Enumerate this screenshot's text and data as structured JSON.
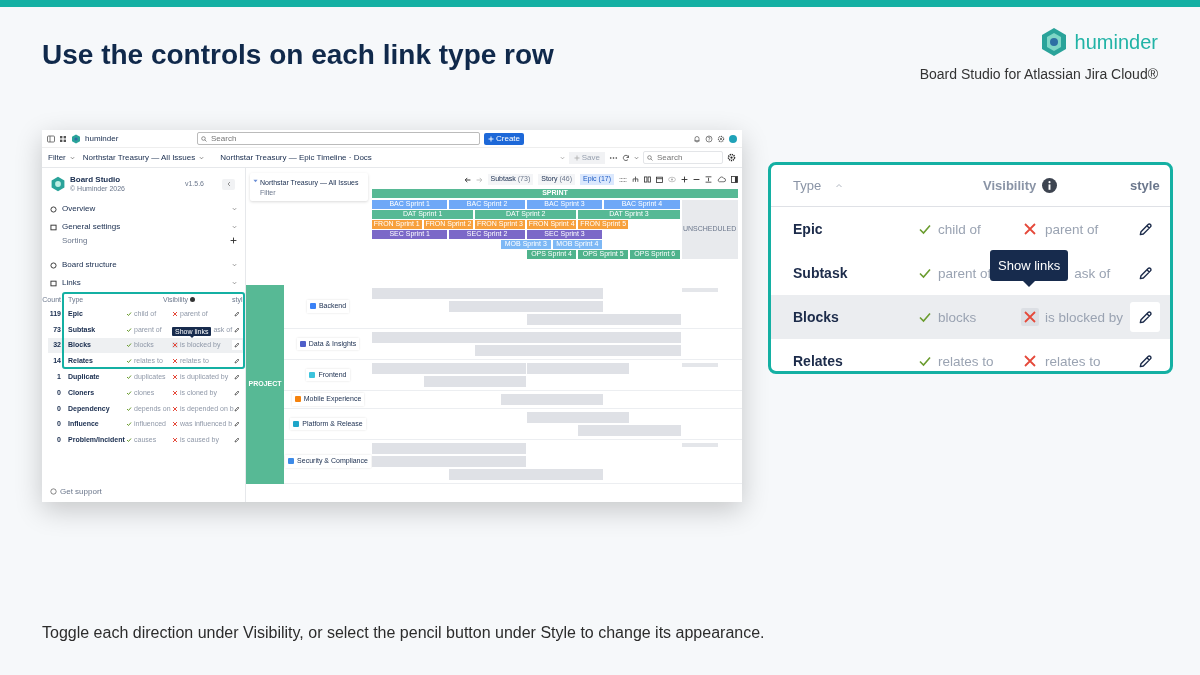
{
  "slide": {
    "title": "Use the controls on each link type row",
    "brand": "huminder",
    "product": "Board Studio for Atlassian Jira Cloud®",
    "caption": "Toggle each direction under Visibility, or select the pencil button under Style to change its appearance."
  },
  "app": {
    "topbar": {
      "brand": "huminder",
      "search_placeholder": "Search",
      "create": "Create"
    },
    "filterbar": {
      "filter": "Filter",
      "board": "Northstar Treasury — All Issues",
      "view": "Northstar Treasury — Epic Timeline · Docs",
      "save": "Save",
      "search_placeholder": "Search"
    },
    "sidebar": {
      "app_name": "Board Studio",
      "copyright": "© Huminder 2026",
      "version": "v1.5.6",
      "sections": [
        {
          "label": "Overview"
        },
        {
          "label": "General settings",
          "children": [
            {
              "label": "Sorting"
            }
          ]
        },
        {
          "label": "Board structure"
        },
        {
          "label": "Links"
        }
      ],
      "links_table": {
        "columns": [
          "Count",
          "Type",
          "Visibility",
          "styl"
        ],
        "rows": [
          {
            "count": "119",
            "type": "Epic",
            "forward": "child of",
            "reverse": "parent of",
            "forward_on": true,
            "reverse_on": false,
            "selected": false
          },
          {
            "count": "73",
            "type": "Subtask",
            "forward": "parent of",
            "reverse": "ask of",
            "forward_on": true,
            "selected": false,
            "tooltip": "Show links"
          },
          {
            "count": "32",
            "type": "Blocks",
            "forward": "blocks",
            "reverse": "is blocked by",
            "forward_on": true,
            "reverse_on": false,
            "selected": true
          },
          {
            "count": "14",
            "type": "Relates",
            "forward": "relates to",
            "reverse": "relates to",
            "forward_on": true,
            "reverse_on": false,
            "selected": false
          },
          {
            "count": "1",
            "type": "Duplicate",
            "forward": "duplicates",
            "reverse": "is duplicated by",
            "forward_on": true,
            "reverse_on": false,
            "selected": false
          },
          {
            "count": "0",
            "type": "Cloners",
            "forward": "clones",
            "reverse": "is cloned by",
            "forward_on": true,
            "reverse_on": false,
            "selected": false
          },
          {
            "count": "0",
            "type": "Dependency",
            "forward": "depends on",
            "reverse": "is depended on b",
            "forward_on": true,
            "reverse_on": false,
            "selected": false
          },
          {
            "count": "0",
            "type": "Influence",
            "forward": "influenced",
            "reverse": "was influenced b",
            "forward_on": true,
            "reverse_on": false,
            "selected": false
          },
          {
            "count": "0",
            "type": "Problem/Incident",
            "forward": "causes",
            "reverse": "is caused by",
            "forward_on": true,
            "reverse_on": false,
            "selected": false
          }
        ]
      },
      "support": "Get support"
    },
    "board": {
      "filter_card": {
        "title": "Northstar Treasury — All Issues",
        "subtitle": "Filter"
      },
      "type_filters": [
        {
          "label": "Subtask",
          "count": "(73)",
          "selected": false
        },
        {
          "label": "Story",
          "count": "(46)",
          "selected": false
        },
        {
          "label": "Epic",
          "count": "(17)",
          "selected": true
        }
      ],
      "sprint_header": "SPRINT",
      "unscheduled": "UNSCHEDULED",
      "sprint_rows": [
        {
          "color": "#6ea8f7",
          "sprints": [
            "BAC Sprint 1",
            "BAC Sprint 2",
            "BAC Sprint 3",
            "BAC Sprint 4"
          ]
        },
        {
          "color": "#57b995",
          "sprints": [
            "DAT Sprint 1",
            "DAT Sprint 2",
            "DAT Sprint 3"
          ]
        },
        {
          "color": "#f7a03c",
          "sprints": [
            "FRON Sprint 1",
            "FRON Sprint 2",
            "FRON Sprint 3",
            "FRON Sprint 4",
            "FRON Sprint 5"
          ]
        },
        {
          "color": "#7b68c8",
          "sprints": [
            "SEC Sprint 1",
            "SEC Sprint 2",
            "SEC Sprint 3"
          ]
        },
        {
          "color": "#7db8f5",
          "sprints": [
            "MOB Sprint 3",
            "MOB Sprint 4"
          ]
        },
        {
          "color": "#4fb38c",
          "sprints": [
            "OPS Sprint 4",
            "OPS Sprint 5",
            "OPS Sprint 6"
          ]
        }
      ],
      "swimlane_group": "PROJECT",
      "lanes": [
        {
          "name": "Backend",
          "color": "#3b82f6"
        },
        {
          "name": "Data & Insights",
          "color": "#4f5fc9"
        },
        {
          "name": "Frontend",
          "color": "#3cc3dc"
        },
        {
          "name": "Mobile Experience",
          "color": "#f5820d"
        },
        {
          "name": "Platform & Release",
          "color": "#1fa6c9"
        },
        {
          "name": "Security & Compliance",
          "color": "#3d8be8"
        }
      ]
    }
  },
  "callout": {
    "columns": [
      "Type",
      "Visibility",
      "style"
    ],
    "rows": [
      {
        "type": "Epic",
        "forward": "child of",
        "reverse": "parent of",
        "forward_on": true,
        "reverse_on": false,
        "selected": false
      },
      {
        "type": "Subtask",
        "forward": "parent of",
        "reverse": "ask of",
        "forward_on": true,
        "selected": false,
        "tooltip": "Show links"
      },
      {
        "type": "Blocks",
        "forward": "blocks",
        "reverse": "is blocked by",
        "forward_on": true,
        "reverse_on": false,
        "selected": true
      },
      {
        "type": "Relates",
        "forward": "relates to",
        "reverse": "relates to",
        "forward_on": true,
        "reverse_on": false,
        "selected": false
      }
    ]
  }
}
